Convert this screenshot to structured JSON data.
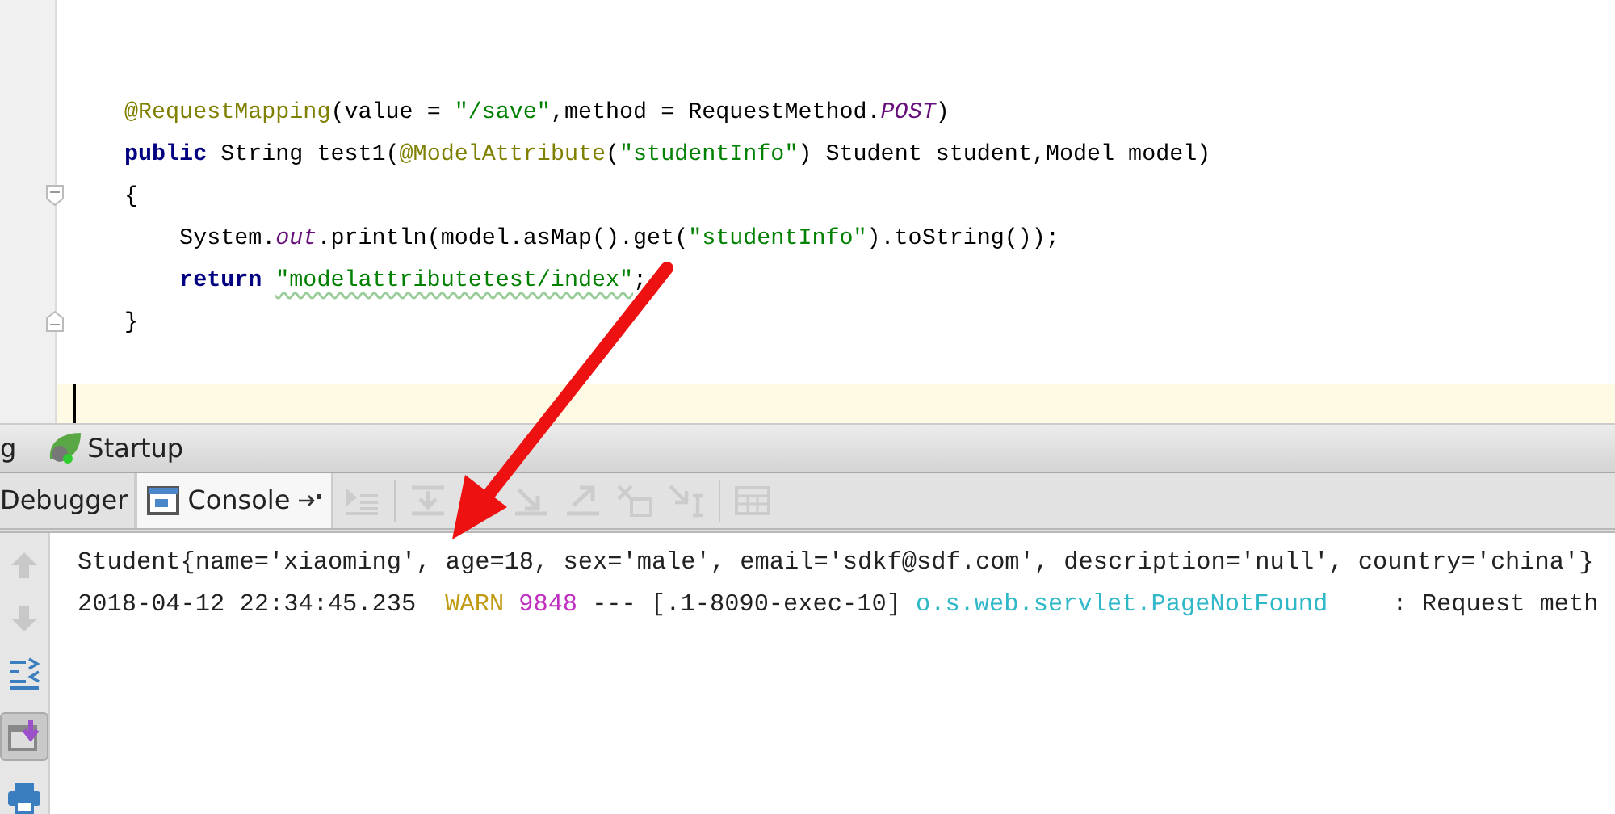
{
  "editor": {
    "code_lines": [
      {
        "tokens": [
          {
            "kind": "annotation",
            "text": "@RequestMapping"
          },
          {
            "kind": "plain",
            "text": "(value = "
          },
          {
            "kind": "string",
            "text": "\"/save\""
          },
          {
            "kind": "plain",
            "text": ",method = RequestMethod."
          },
          {
            "kind": "constant",
            "text": "POST"
          },
          {
            "kind": "plain",
            "text": ")"
          }
        ]
      },
      {
        "tokens": [
          {
            "kind": "keyword",
            "text": "public"
          },
          {
            "kind": "plain",
            "text": " String test1("
          },
          {
            "kind": "annotation",
            "text": "@ModelAttribute"
          },
          {
            "kind": "plain",
            "text": "("
          },
          {
            "kind": "string",
            "text": "\"studentInfo\""
          },
          {
            "kind": "plain",
            "text": ") Student student,Model model)"
          }
        ]
      },
      {
        "tokens": [
          {
            "kind": "plain",
            "text": "{"
          }
        ]
      },
      {
        "tokens": [
          {
            "kind": "plain",
            "text": "    System."
          },
          {
            "kind": "constant",
            "text": "out"
          },
          {
            "kind": "plain",
            "text": ".println(model.asMap().get("
          },
          {
            "kind": "string",
            "text": "\"studentInfo\""
          },
          {
            "kind": "plain",
            "text": ").toString());"
          }
        ]
      },
      {
        "tokens": [
          {
            "kind": "keyword",
            "text": "    return "
          },
          {
            "kind": "string",
            "text": "\"modelattributetest/index\"",
            "misspelled": true
          },
          {
            "kind": "plain",
            "text": ";"
          }
        ]
      },
      {
        "tokens": [
          {
            "kind": "plain",
            "text": "}"
          }
        ]
      }
    ]
  },
  "run_window": {
    "titles": [
      "g",
      "Startup"
    ],
    "tabs": [
      {
        "label": "Debugger",
        "selected": false
      },
      {
        "label": "Console",
        "selected": true
      }
    ],
    "console_lines": [
      {
        "tokens": [
          {
            "kind": "plain",
            "text": "Student{name='xiaoming', age=18, sex='male', email='sdkf@sdf.com', description='null', country='china'}"
          }
        ]
      },
      {
        "tokens": [
          {
            "kind": "plain",
            "text": "2018-04-12 22:34:45.235"
          },
          {
            "kind": "level",
            "text": "WARN"
          },
          {
            "kind": "pid",
            "text": "9848"
          },
          {
            "kind": "plain",
            "text": "--- [.1-8090-exec-10]"
          },
          {
            "kind": "logger",
            "text": "o.s.web.servlet.PageNotFound"
          },
          {
            "kind": "message",
            "text": ": Request meth"
          }
        ]
      }
    ]
  }
}
